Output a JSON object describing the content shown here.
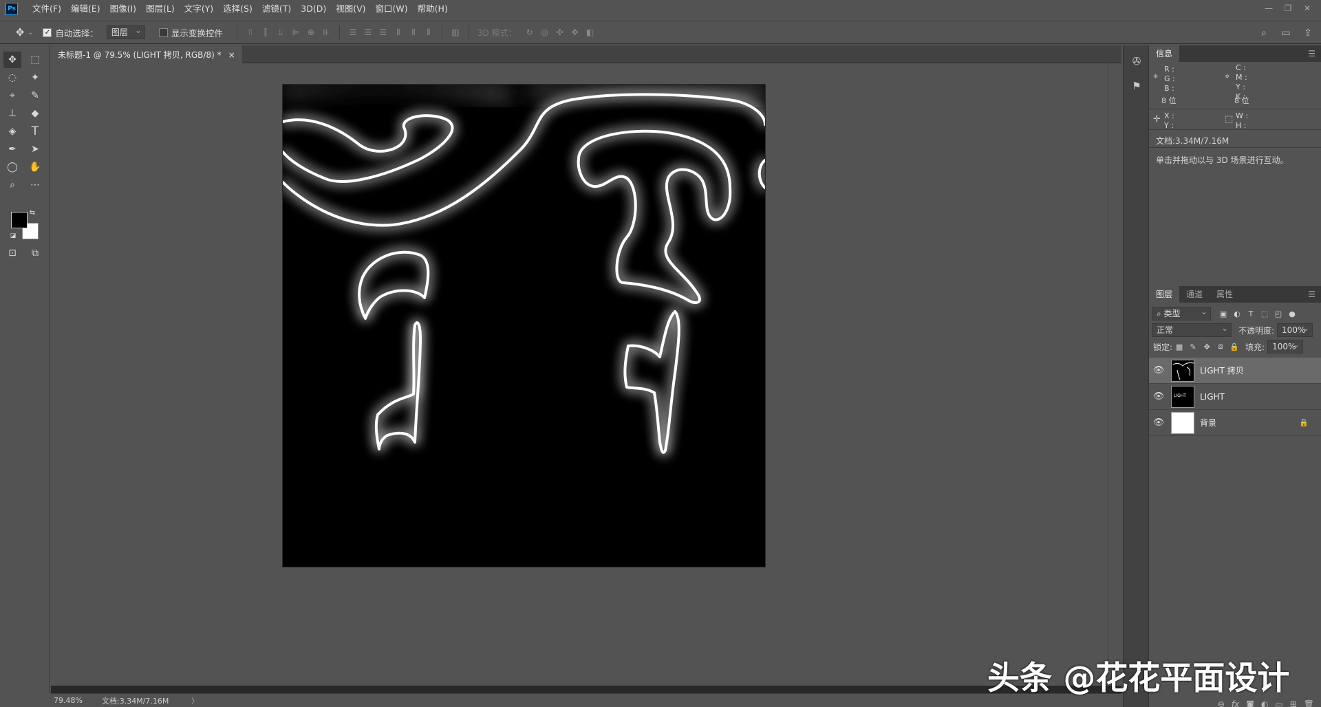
{
  "app": {
    "logo": "Ps"
  },
  "menu": [
    "文件(F)",
    "编辑(E)",
    "图像(I)",
    "图层(L)",
    "文字(Y)",
    "选择(S)",
    "滤镜(T)",
    "3D(D)",
    "视图(V)",
    "窗口(W)",
    "帮助(H)"
  ],
  "options": {
    "auto_select_label": "自动选择：",
    "auto_select_value": "图层",
    "show_transform_label": "显示变换控件",
    "mode_3d_label": "3D 模式："
  },
  "document": {
    "tab_title": "未标题-1 @ 79.5% (LIGHT 拷贝, RGB/8) *",
    "close": "×"
  },
  "status": {
    "zoom": "79.48%",
    "doc_size": "文档:3.34M/7.16M",
    "arrow": "〉"
  },
  "info_panel": {
    "tab": "信息",
    "rgb_labels": "R :\nG :\nB :",
    "bit_left": "8 位",
    "cmyk_labels": "C :\nM :\nY :\nK :",
    "bit_right": "8 位",
    "xy_labels": "X :\nY :",
    "wh_labels": "W :\nH :",
    "doc_size": "文档:3.34M/7.16M",
    "hint": "单击并拖动以与 3D 场景进行互动。"
  },
  "layers_panel": {
    "tabs": [
      "图层",
      "通道",
      "属性"
    ],
    "filter": "类型",
    "blend_mode": "正常",
    "opacity_label": "不透明度:",
    "opacity_value": "100%",
    "lock_label": "锁定:",
    "fill_label": "填充:",
    "fill_value": "100%",
    "layers": [
      {
        "name": "LIGHT 拷贝",
        "selected": true,
        "thumb": "black",
        "thumb_text": "",
        "locked": false
      },
      {
        "name": "LIGHT",
        "selected": false,
        "thumb": "black",
        "thumb_text": "LIGHT",
        "locked": false
      },
      {
        "name": "背景",
        "selected": false,
        "thumb": "white",
        "thumb_text": "",
        "locked": true
      }
    ]
  },
  "watermark": "头条 @花花平面设计",
  "colors": {
    "accent": "#31a8ff",
    "panel_bg": "#535353",
    "dark_bg": "#424242"
  }
}
